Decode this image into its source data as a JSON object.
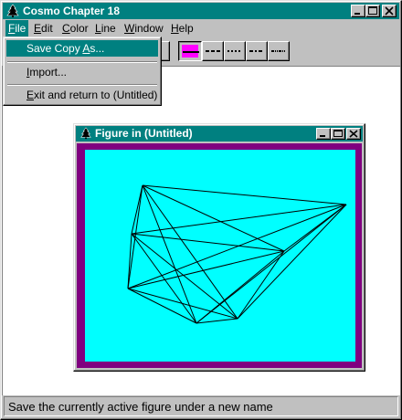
{
  "app": {
    "title": "Cosmo Chapter 18"
  },
  "menubar": {
    "items": [
      {
        "label": "File",
        "accel": "F",
        "rest": "ile",
        "active": true
      },
      {
        "label": "Edit",
        "accel": "E",
        "rest": "dit"
      },
      {
        "label": "Color",
        "accel": "C",
        "rest": "olor"
      },
      {
        "label": "Line",
        "accel": "L",
        "rest": "ine"
      },
      {
        "label": "Window",
        "accel": "W",
        "rest": "indow"
      },
      {
        "label": "Help",
        "accel": "H",
        "rest": "elp"
      }
    ]
  },
  "file_menu": {
    "items": [
      {
        "label": "Save Copy As...",
        "pre": "Save Copy ",
        "accel": "A",
        "post": "s...",
        "highlighted": true
      },
      {
        "label": "Import...",
        "pre": "",
        "accel": "I",
        "post": "mport..."
      },
      {
        "label": "Exit and return to (Untitled)",
        "pre": "",
        "accel": "E",
        "post": "xit and return to (Untitled)"
      }
    ]
  },
  "toolbar": {
    "line_styles": [
      "solid",
      "dash",
      "dot",
      "dashdot",
      "dashdotdot"
    ],
    "selected_style": "solid",
    "selected_color": "#ff00ff"
  },
  "figure_window": {
    "title": "Figure in (Untitled)",
    "background_color": "#00ffff",
    "border_color": "#800080",
    "line_color": "#000000"
  },
  "status": {
    "text": "Save the currently active figure under a new name"
  },
  "colors": {
    "titlebar": "#008080",
    "face": "#c0c0c0",
    "highlight": "#008080"
  }
}
